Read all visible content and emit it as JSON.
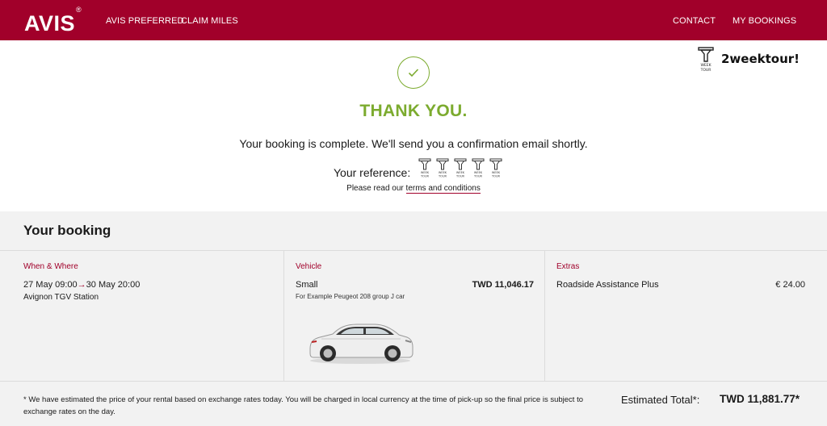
{
  "header": {
    "logo": "AVIS",
    "logo_mark": "®",
    "nav": [
      "AVIS PREFERRED",
      "CLAIM MILES"
    ],
    "nav_right": [
      "CONTACT",
      "MY BOOKINGS"
    ]
  },
  "watermark": {
    "logo_lines": [
      "WEEK",
      "TOUR"
    ],
    "text": "2weektour!"
  },
  "confirmation": {
    "check_icon": "check-icon",
    "title": "THANK YOU.",
    "message": "Your booking is complete. We'll send you a confirmation email shortly.",
    "reference_label": "Your reference:",
    "terms_prefix": "Please read our ",
    "terms_link": "terms and conditions"
  },
  "booking": {
    "title": "Your booking",
    "when_where": {
      "heading": "When & Where",
      "pickup": "27 May 09:00",
      "dropoff": "30 May 20:00",
      "location": "Avignon TGV Station"
    },
    "vehicle": {
      "heading": "Vehicle",
      "class": "Small",
      "example": "For Example Peugeot 208 group J car",
      "price": "TWD 11,046.17"
    },
    "extras": {
      "heading": "Extras",
      "item": "Roadside Assistance Plus",
      "price": "€ 24.00"
    },
    "footnote": "* We have estimated the price of your rental based on exchange rates today. You will be charged in local currency at the time of pick-up so the final price is subject to exchange rates on the day.",
    "estimated_label": "Estimated Total*:",
    "estimated_value": "TWD 11,881.77*"
  },
  "colors": {
    "brand": "#a1002a",
    "success": "#7cab2f",
    "panel": "#f2f2f2"
  }
}
